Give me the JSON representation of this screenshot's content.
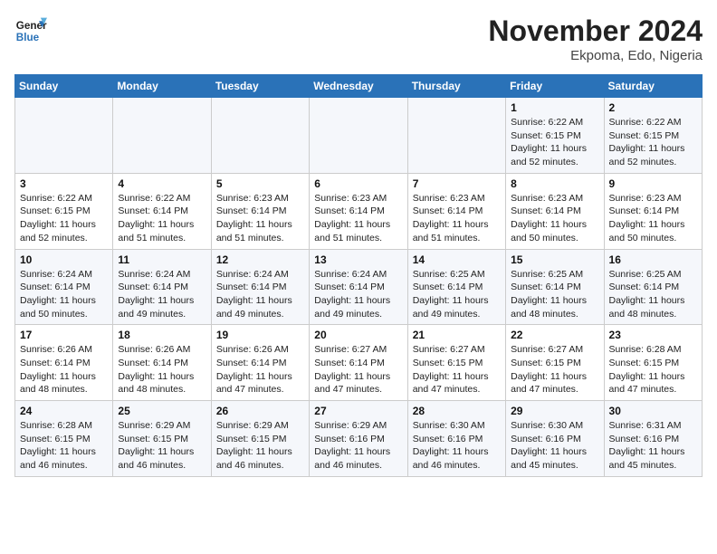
{
  "header": {
    "logo_line1": "General",
    "logo_line2": "Blue",
    "month": "November 2024",
    "location": "Ekpoma, Edo, Nigeria"
  },
  "weekdays": [
    "Sunday",
    "Monday",
    "Tuesday",
    "Wednesday",
    "Thursday",
    "Friday",
    "Saturday"
  ],
  "weeks": [
    [
      {
        "day": "",
        "info": ""
      },
      {
        "day": "",
        "info": ""
      },
      {
        "day": "",
        "info": ""
      },
      {
        "day": "",
        "info": ""
      },
      {
        "day": "",
        "info": ""
      },
      {
        "day": "1",
        "info": "Sunrise: 6:22 AM\nSunset: 6:15 PM\nDaylight: 11 hours\nand 52 minutes."
      },
      {
        "day": "2",
        "info": "Sunrise: 6:22 AM\nSunset: 6:15 PM\nDaylight: 11 hours\nand 52 minutes."
      }
    ],
    [
      {
        "day": "3",
        "info": "Sunrise: 6:22 AM\nSunset: 6:15 PM\nDaylight: 11 hours\nand 52 minutes."
      },
      {
        "day": "4",
        "info": "Sunrise: 6:22 AM\nSunset: 6:14 PM\nDaylight: 11 hours\nand 51 minutes."
      },
      {
        "day": "5",
        "info": "Sunrise: 6:23 AM\nSunset: 6:14 PM\nDaylight: 11 hours\nand 51 minutes."
      },
      {
        "day": "6",
        "info": "Sunrise: 6:23 AM\nSunset: 6:14 PM\nDaylight: 11 hours\nand 51 minutes."
      },
      {
        "day": "7",
        "info": "Sunrise: 6:23 AM\nSunset: 6:14 PM\nDaylight: 11 hours\nand 51 minutes."
      },
      {
        "day": "8",
        "info": "Sunrise: 6:23 AM\nSunset: 6:14 PM\nDaylight: 11 hours\nand 50 minutes."
      },
      {
        "day": "9",
        "info": "Sunrise: 6:23 AM\nSunset: 6:14 PM\nDaylight: 11 hours\nand 50 minutes."
      }
    ],
    [
      {
        "day": "10",
        "info": "Sunrise: 6:24 AM\nSunset: 6:14 PM\nDaylight: 11 hours\nand 50 minutes."
      },
      {
        "day": "11",
        "info": "Sunrise: 6:24 AM\nSunset: 6:14 PM\nDaylight: 11 hours\nand 49 minutes."
      },
      {
        "day": "12",
        "info": "Sunrise: 6:24 AM\nSunset: 6:14 PM\nDaylight: 11 hours\nand 49 minutes."
      },
      {
        "day": "13",
        "info": "Sunrise: 6:24 AM\nSunset: 6:14 PM\nDaylight: 11 hours\nand 49 minutes."
      },
      {
        "day": "14",
        "info": "Sunrise: 6:25 AM\nSunset: 6:14 PM\nDaylight: 11 hours\nand 49 minutes."
      },
      {
        "day": "15",
        "info": "Sunrise: 6:25 AM\nSunset: 6:14 PM\nDaylight: 11 hours\nand 48 minutes."
      },
      {
        "day": "16",
        "info": "Sunrise: 6:25 AM\nSunset: 6:14 PM\nDaylight: 11 hours\nand 48 minutes."
      }
    ],
    [
      {
        "day": "17",
        "info": "Sunrise: 6:26 AM\nSunset: 6:14 PM\nDaylight: 11 hours\nand 48 minutes."
      },
      {
        "day": "18",
        "info": "Sunrise: 6:26 AM\nSunset: 6:14 PM\nDaylight: 11 hours\nand 48 minutes."
      },
      {
        "day": "19",
        "info": "Sunrise: 6:26 AM\nSunset: 6:14 PM\nDaylight: 11 hours\nand 47 minutes."
      },
      {
        "day": "20",
        "info": "Sunrise: 6:27 AM\nSunset: 6:14 PM\nDaylight: 11 hours\nand 47 minutes."
      },
      {
        "day": "21",
        "info": "Sunrise: 6:27 AM\nSunset: 6:15 PM\nDaylight: 11 hours\nand 47 minutes."
      },
      {
        "day": "22",
        "info": "Sunrise: 6:27 AM\nSunset: 6:15 PM\nDaylight: 11 hours\nand 47 minutes."
      },
      {
        "day": "23",
        "info": "Sunrise: 6:28 AM\nSunset: 6:15 PM\nDaylight: 11 hours\nand 47 minutes."
      }
    ],
    [
      {
        "day": "24",
        "info": "Sunrise: 6:28 AM\nSunset: 6:15 PM\nDaylight: 11 hours\nand 46 minutes."
      },
      {
        "day": "25",
        "info": "Sunrise: 6:29 AM\nSunset: 6:15 PM\nDaylight: 11 hours\nand 46 minutes."
      },
      {
        "day": "26",
        "info": "Sunrise: 6:29 AM\nSunset: 6:15 PM\nDaylight: 11 hours\nand 46 minutes."
      },
      {
        "day": "27",
        "info": "Sunrise: 6:29 AM\nSunset: 6:16 PM\nDaylight: 11 hours\nand 46 minutes."
      },
      {
        "day": "28",
        "info": "Sunrise: 6:30 AM\nSunset: 6:16 PM\nDaylight: 11 hours\nand 46 minutes."
      },
      {
        "day": "29",
        "info": "Sunrise: 6:30 AM\nSunset: 6:16 PM\nDaylight: 11 hours\nand 45 minutes."
      },
      {
        "day": "30",
        "info": "Sunrise: 6:31 AM\nSunset: 6:16 PM\nDaylight: 11 hours\nand 45 minutes."
      }
    ]
  ]
}
